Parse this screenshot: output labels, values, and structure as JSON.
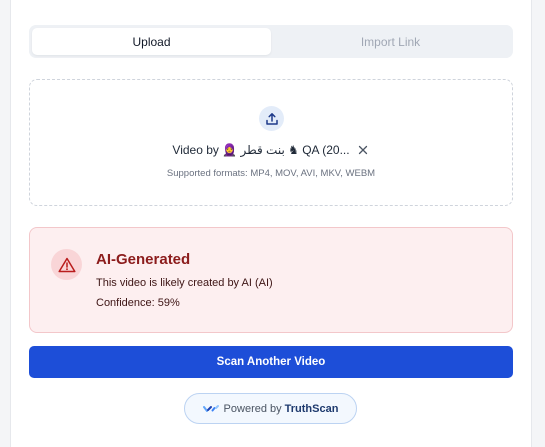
{
  "tabs": [
    {
      "label": "Upload",
      "active": true
    },
    {
      "label": "Import Link",
      "active": false
    }
  ],
  "dropzone": {
    "upload_icon": "upload-icon",
    "file_name": "Video by 🧕 بنت قطر ♞ QA (20...",
    "remove_icon": "close-icon",
    "supported_formats": "Supported formats: MP4, MOV, AVI, MKV, WEBM"
  },
  "result": {
    "icon": "warning-triangle-icon",
    "title": "AI-Generated",
    "description": "This video is likely created by AI (AI)",
    "confidence": "Confidence: 59%",
    "colors": {
      "background": "#fdeff0",
      "border": "#f3c7ca",
      "title": "#8c1c1c"
    }
  },
  "scan_button": {
    "label": "Scan Another Video",
    "color": "#1d4ed8"
  },
  "powered_by": {
    "prefix": "Powered by",
    "brand": "TruthScan",
    "icon": "truthscan-logo-icon"
  }
}
